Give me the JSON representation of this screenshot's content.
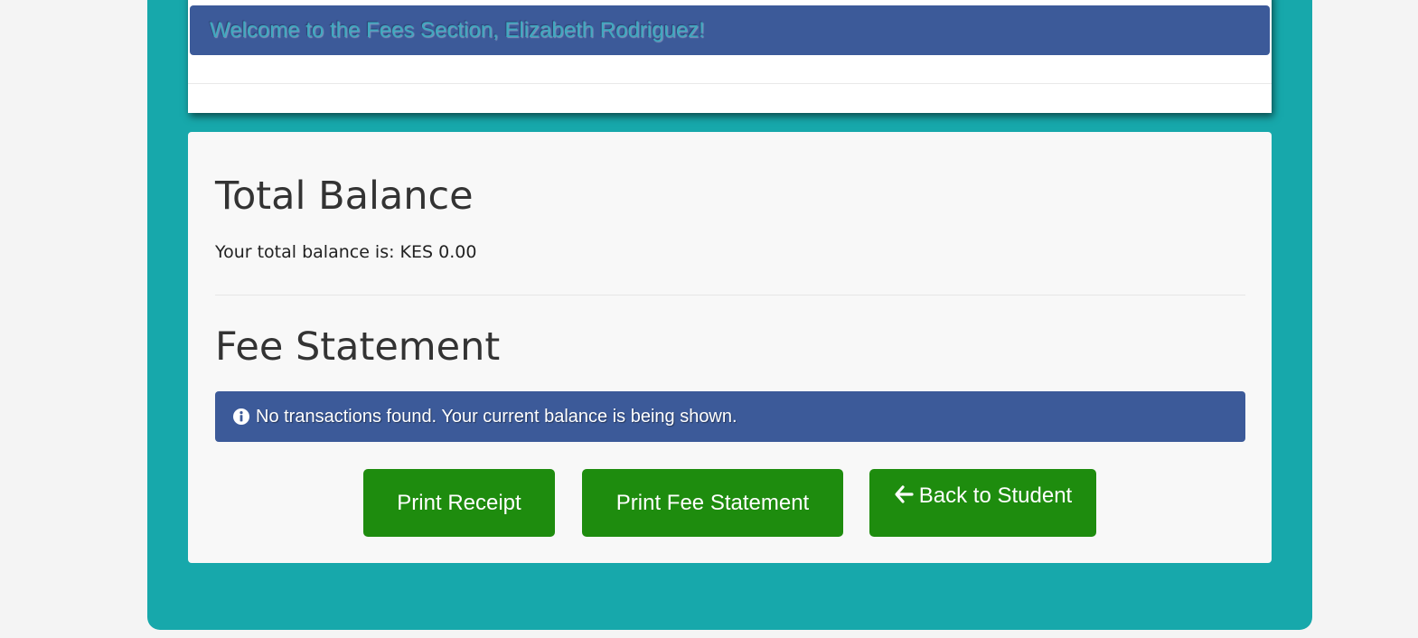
{
  "welcome": {
    "message": "Welcome to the Fees Section, Elizabeth Rodriguez!"
  },
  "balance": {
    "heading": "Total Balance",
    "text": "Your total balance is: KES 0.00"
  },
  "statement": {
    "heading": "Fee Statement",
    "info_icon": "info-circle-icon",
    "info_message": "No transactions found. Your current balance is being shown."
  },
  "buttons": {
    "print_receipt": "Print Receipt",
    "print_fee_statement": "Print Fee Statement",
    "back_icon": "arrow-left-icon",
    "back_to_student": "Back to Student"
  },
  "colors": {
    "page_background": "#f4f4f4",
    "frame_teal": "#17a8ab",
    "banner_blue": "#3c5a99",
    "welcome_text": "#3fa9c0",
    "button_green": "#1e8c0e"
  }
}
